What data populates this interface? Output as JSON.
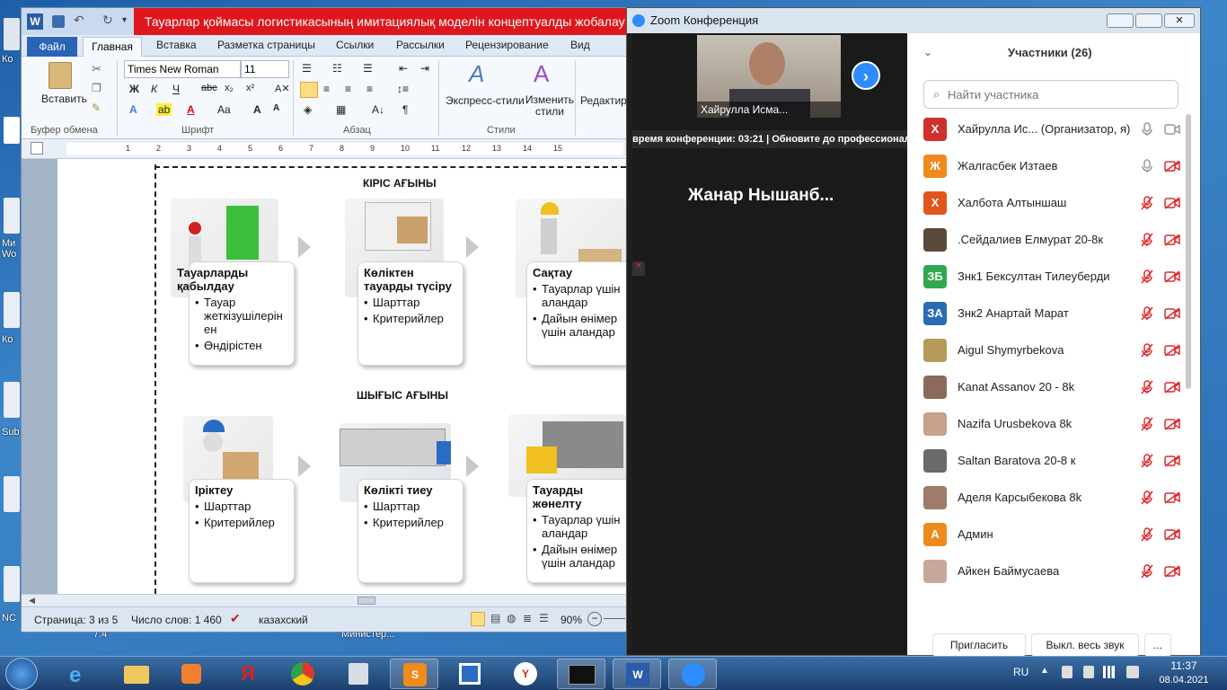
{
  "desktop": {
    "icons": [
      "Ко",
      "Ми\nWo",
      "Ко",
      "Sub",
      "NC",
      "7.4",
      "Министер..."
    ]
  },
  "word": {
    "title": "Тауарлар қоймасы логистикасының имитациялық моделін концептуалды жобалау  -  Micros...",
    "tabs": [
      "Файл",
      "Главная",
      "Вставка",
      "Разметка страницы",
      "Ссылки",
      "Рассылки",
      "Рецензирование",
      "Вид"
    ],
    "ribbon": {
      "paste": "Вставить",
      "group_clipboard": "Буфер обмена",
      "font_name": "Times New Roman",
      "font_size": "11",
      "group_font": "Шрифт",
      "group_paragraph": "Абзац",
      "styles_express": "Экспресс-стили",
      "styles_change": "Изменить стили",
      "group_styles": "Стили",
      "editing": "Редактир"
    },
    "ruler_numbers": [
      "1",
      "2",
      "3",
      "4",
      "5",
      "6",
      "7",
      "8",
      "9",
      "10",
      "11",
      "12",
      "13",
      "14",
      "15"
    ],
    "doc": {
      "heading_in": "КІРІС АҒЫНЫ",
      "heading_out": "ШЫҒЫС АҒЫНЫ",
      "in_cards": [
        {
          "title": "Тауарларды қабылдау",
          "items": [
            "Тауар жеткізушілерін ен",
            "Өндірістен"
          ]
        },
        {
          "title": "Көліктен тауарды түсіру",
          "items": [
            "Шарттар",
            "Критерийлер"
          ]
        },
        {
          "title": "Сақтау",
          "items": [
            "Тауарлар үшін аландар",
            "Дайын өнімер үшін аландар"
          ]
        }
      ],
      "out_cards": [
        {
          "title": "Іріктеу",
          "items": [
            "Шарттар",
            "Критерийлер"
          ]
        },
        {
          "title": "Көлікті тиеу",
          "items": [
            "Шарттар",
            "Критерийлер"
          ]
        },
        {
          "title": "Тауарды жөнелту",
          "items": [
            "Тауарлар үшін аландар",
            "Дайын өнімер үшін аландар"
          ]
        }
      ]
    },
    "status": {
      "page": "Страница: 3 из 5",
      "words": "Число слов: 1 460",
      "lang": "казахский",
      "zoom": "90%"
    }
  },
  "zoom": {
    "title": "Zoom Конференция",
    "speaker_name": "Хайрулла Исма...",
    "banner": "время конференции: 03:21 | Обновите до профессионал",
    "active_name": "Жанар  Нышанб...",
    "panel_title": "Участники (26)",
    "search_placeholder": "Найти участника",
    "participants": [
      {
        "initial": "Х",
        "color": "#d0302c",
        "name": "Хайрулла Ис...   (Организатор, я)",
        "muted": false,
        "video_off": false
      },
      {
        "initial": "Ж",
        "color": "#f08a1c",
        "name": "Жалгасбек Изтаев",
        "muted": false,
        "video_off": true
      },
      {
        "initial": "Х",
        "color": "#e0561c",
        "name": "Халбота Алтыншаш",
        "muted": true,
        "video_off": true
      },
      {
        "initial": "",
        "color": "#5a4a3a",
        "name": ".Сейдалиев Елмурат 20-8к",
        "muted": true,
        "video_off": true
      },
      {
        "initial": "ЗБ",
        "color": "#2fa84f",
        "name": "Знк1 Бексултан Тилеуберди",
        "muted": true,
        "video_off": true
      },
      {
        "initial": "ЗА",
        "color": "#2a6cb4",
        "name": "Знк2 Анартай Марат",
        "muted": true,
        "video_off": true
      },
      {
        "initial": "",
        "color": "#b89a5a",
        "name": "Aigul Shymyrbekova",
        "muted": true,
        "video_off": true
      },
      {
        "initial": "",
        "color": "#8a6a5a",
        "name": "Kanat Assanov 20 - 8k",
        "muted": true,
        "video_off": true
      },
      {
        "initial": "",
        "color": "#c9a08a",
        "name": "Nazifa Urusbekova 8k",
        "muted": true,
        "video_off": true
      },
      {
        "initial": "",
        "color": "#6a6a6a",
        "name": "Saltan Baratova 20-8 к",
        "muted": true,
        "video_off": true
      },
      {
        "initial": "",
        "color": "#a07a6a",
        "name": "Аделя Карсыбекова 8k",
        "muted": true,
        "video_off": true
      },
      {
        "initial": "А",
        "color": "#f08a1c",
        "name": "Админ",
        "muted": true,
        "video_off": true
      },
      {
        "initial": "",
        "color": "#c8a89a",
        "name": "Айкен Баймусаева",
        "muted": true,
        "video_off": true
      }
    ],
    "invite": "Пригласить",
    "mute_all": "Выкл. весь звук",
    "more": "..."
  },
  "taskbar": {
    "lang": "RU",
    "time": "11:37",
    "date": "08.04.2021"
  },
  "colors": {
    "accent": "#2d8cff",
    "word_red": "#e0161d",
    "mute_red": "#e0282e"
  }
}
